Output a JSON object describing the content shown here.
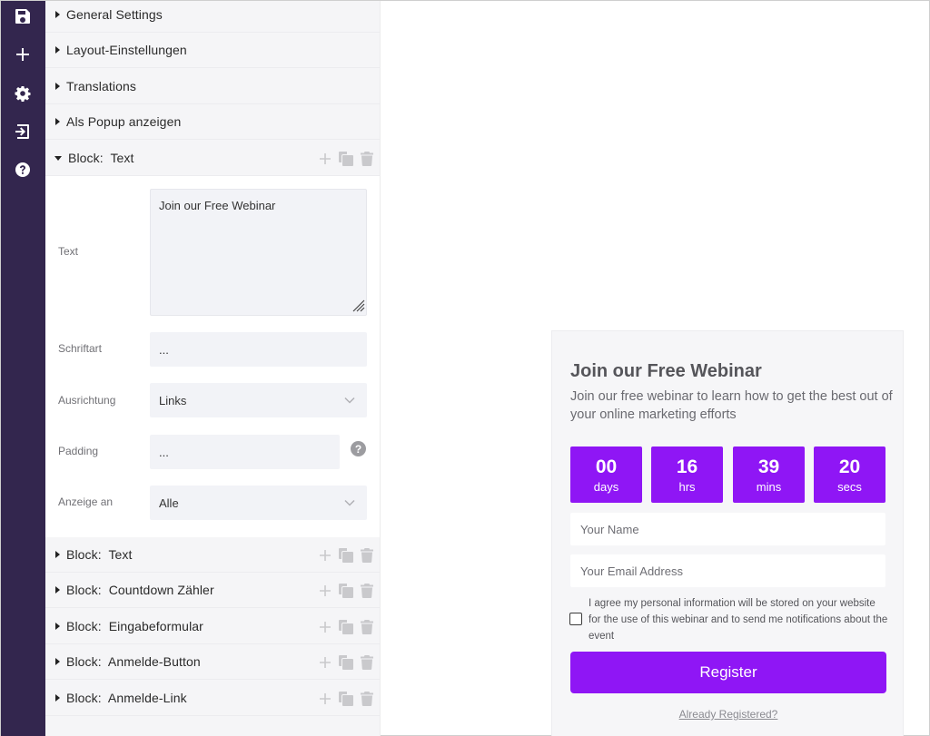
{
  "sidebar": {
    "icons": [
      "save-icon",
      "plus-icon",
      "gear-icon",
      "login-icon",
      "help-icon"
    ]
  },
  "panel": {
    "sections": [
      {
        "label": "General Settings"
      },
      {
        "label": "Layout-Einstellungen"
      },
      {
        "label": "Translations"
      },
      {
        "label": "Als Popup anzeigen"
      }
    ],
    "open_block": {
      "label": "Block:  Text",
      "fields": {
        "text_label": "Text",
        "text_value": "Join our Free Webinar",
        "font_label": "Schriftart",
        "font_value": "...",
        "align_label": "Ausrichtung",
        "align_value": "Links",
        "padding_label": "Padding",
        "padding_value": "...",
        "display_label": "Anzeige an",
        "display_value": "Alle"
      }
    },
    "blocks": [
      {
        "label": "Block:  Text"
      },
      {
        "label": "Block:  Countdown Zähler"
      },
      {
        "label": "Block:  Eingabeformular"
      },
      {
        "label": "Block:  Anmelde-Button"
      },
      {
        "label": "Block:  Anmelde-Link"
      }
    ]
  },
  "preview": {
    "title": "Join our Free Webinar",
    "subtitle": "Join our free webinar to learn how to get the best out of your online marketing efforts",
    "countdown": [
      {
        "value": "00",
        "unit": "days"
      },
      {
        "value": "16",
        "unit": "hrs"
      },
      {
        "value": "39",
        "unit": "mins"
      },
      {
        "value": "20",
        "unit": "secs"
      }
    ],
    "name_placeholder": "Your Name",
    "email_placeholder": "Your Email Address",
    "consent_text": "I agree my personal information will be stored on your website for the use of this webinar and to send me notifications about the event",
    "register_label": "Register",
    "already_label": "Already Registered?"
  },
  "colors": {
    "sidebar_bg": "#33264e",
    "accent": "#8f16f5",
    "panel_bg": "#f5f5f7"
  }
}
